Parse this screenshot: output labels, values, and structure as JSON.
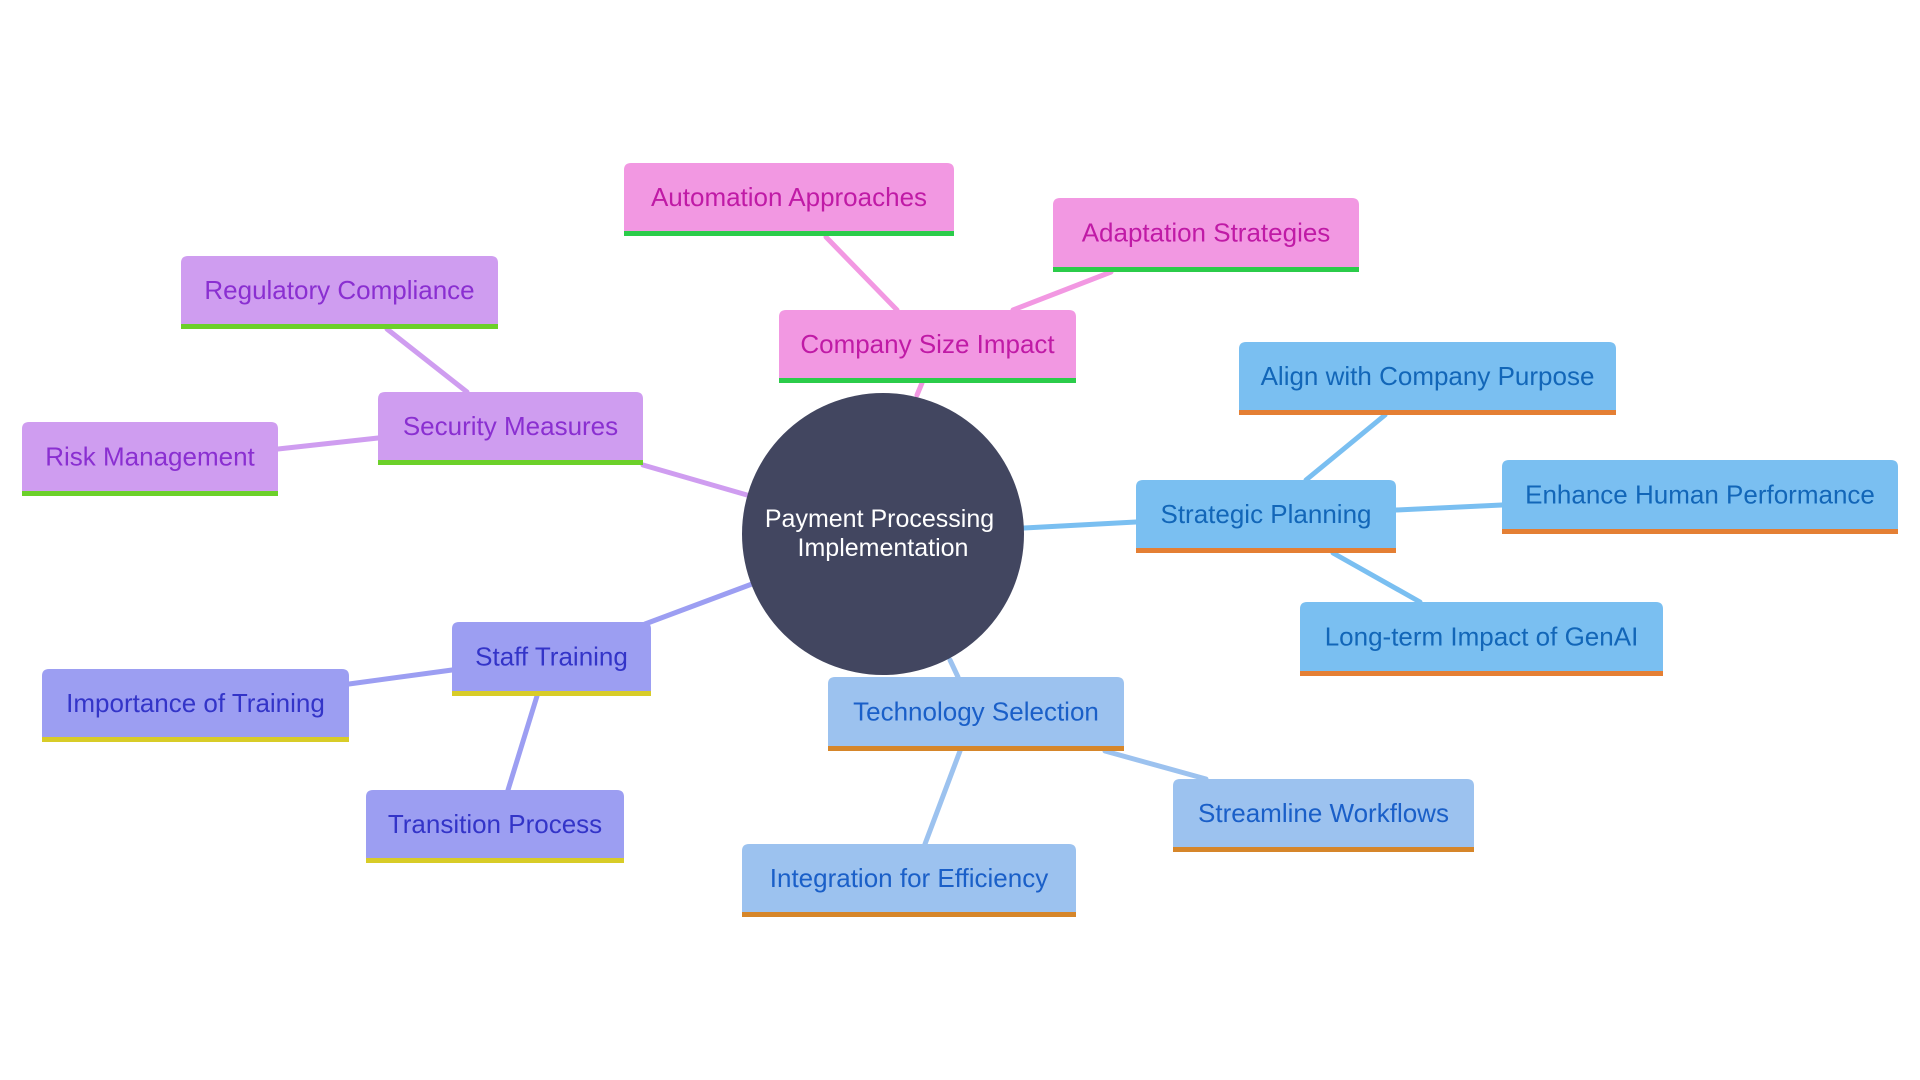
{
  "diagram": {
    "type": "mindmap",
    "root": {
      "id": "root",
      "label_lines": [
        "Payment Processing",
        "Implementation"
      ],
      "fill": "#424660"
    },
    "branches": [
      {
        "id": "company-size",
        "label": "Company Size Impact",
        "fill": "#f298e2",
        "text": "#c01aa6",
        "underline": "#2bcc4a",
        "edge": "#f298e2",
        "children": [
          {
            "id": "automation",
            "label": "Automation Approaches"
          },
          {
            "id": "adaptation",
            "label": "Adaptation Strategies"
          }
        ]
      },
      {
        "id": "security",
        "label": "Security Measures",
        "fill": "#cf9df0",
        "text": "#8a2fd1",
        "underline": "#6cd02a",
        "edge": "#cf9df0",
        "children": [
          {
            "id": "regulatory",
            "label": "Regulatory Compliance"
          },
          {
            "id": "risk",
            "label": "Risk Management"
          }
        ]
      },
      {
        "id": "staff-training",
        "label": "Staff Training",
        "fill": "#9c9ef2",
        "text": "#3334c8",
        "underline": "#d8cc28",
        "edge": "#9c9ef2",
        "children": [
          {
            "id": "importance",
            "label": "Importance of Training"
          },
          {
            "id": "transition",
            "label": "Transition Process"
          }
        ]
      },
      {
        "id": "technology",
        "label": "Technology Selection",
        "fill": "#9cc2ef",
        "text": "#1a5fc8",
        "underline": "#d6862a",
        "edge": "#9cc2ef",
        "children": [
          {
            "id": "streamline",
            "label": "Streamline Workflows"
          },
          {
            "id": "integration",
            "label": "Integration for Efficiency"
          }
        ]
      },
      {
        "id": "strategic",
        "label": "Strategic Planning",
        "fill": "#7abff1",
        "text": "#1266b8",
        "underline": "#e47f34",
        "edge": "#7abff1",
        "children": [
          {
            "id": "align",
            "label": "Align with Company Purpose"
          },
          {
            "id": "enhance",
            "label": "Enhance Human Performance"
          },
          {
            "id": "longterm",
            "label": "Long-term Impact of GenAI"
          }
        ]
      }
    ]
  }
}
